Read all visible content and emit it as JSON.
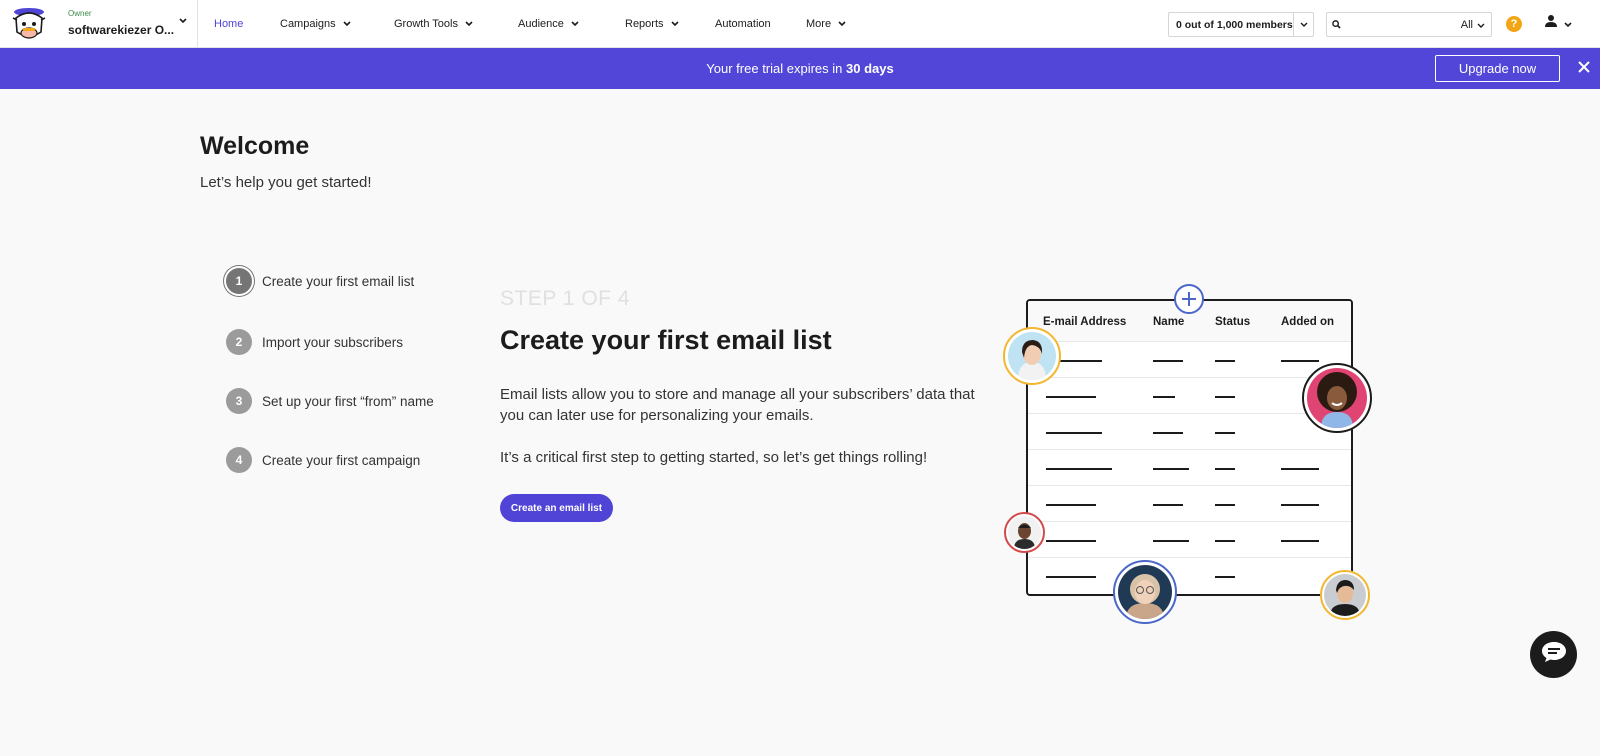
{
  "header": {
    "account_role": "Owner",
    "account_name": "softwarekiezer O...",
    "nav": [
      {
        "label": "Home",
        "active": true
      },
      {
        "label": "Campaigns"
      },
      {
        "label": "Growth Tools"
      },
      {
        "label": "Audience"
      },
      {
        "label": "Reports"
      },
      {
        "label": "Automation"
      },
      {
        "label": "More"
      }
    ],
    "members": "0 out of 1,000 members",
    "search_scope": "All",
    "help_label": "?"
  },
  "banner": {
    "message_prefix": "Your free trial expires in ",
    "message_bold": "30 days",
    "upgrade_label": "Upgrade now"
  },
  "welcome": {
    "title": "Welcome",
    "subtitle": "Let’s help you get started!"
  },
  "steps": [
    {
      "num": "1",
      "label": "Create your first email list"
    },
    {
      "num": "2",
      "label": "Import your subscribers"
    },
    {
      "num": "3",
      "label": "Set up your first “from” name"
    },
    {
      "num": "4",
      "label": "Create your first campaign"
    }
  ],
  "content": {
    "step_indicator": "STEP 1 OF 4",
    "heading": "Create your first email list",
    "paragraph1": "Email lists allow you to store and manage all your subscribers’ data that you can later use for personalizing your emails.",
    "paragraph2": "It’s a critical first step to getting started, so let’s get things rolling!",
    "cta_label": "Create an email list"
  },
  "illustration": {
    "columns": [
      "E-mail Address",
      "Name",
      "Status",
      "Added on"
    ]
  },
  "colors": {
    "brand": "#5146d8",
    "help": "#f2a615"
  }
}
